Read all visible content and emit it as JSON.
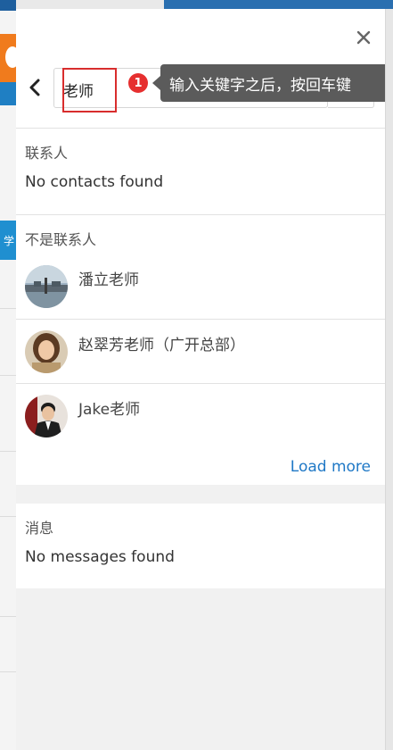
{
  "search": {
    "value": "老师"
  },
  "callout": {
    "number": "1",
    "text": "输入关键字之后，按回车键"
  },
  "contacts_section": {
    "title": "联系人",
    "empty": "No contacts found"
  },
  "non_contacts_section": {
    "title": "不是联系人",
    "items": [
      {
        "name": "潘立老师",
        "avatar": "landscape-photo-avatar"
      },
      {
        "name": "赵翠芳老师（广开总部）",
        "avatar": "woman-photo-avatar"
      },
      {
        "name": "Jake老师",
        "avatar": "man-photo-avatar"
      }
    ],
    "load_more": "Load more"
  },
  "messages_section": {
    "title": "消息",
    "empty": "No messages found"
  },
  "background": {
    "partial_text": "学"
  },
  "colors": {
    "accent_link": "#1f78c6",
    "highlight_box": "#d82d2d",
    "callout_bg": "#5b5b5b",
    "callout_badge": "#e62f2f"
  },
  "icons": {
    "close": "close-icon",
    "back": "chevron-left-icon"
  }
}
